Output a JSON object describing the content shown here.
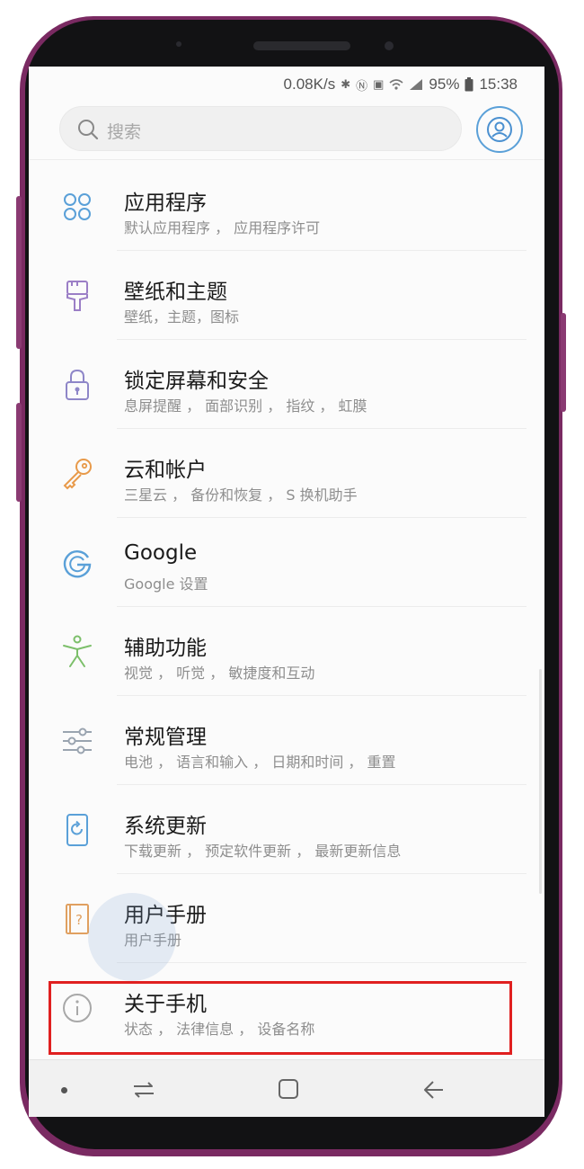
{
  "status_bar": {
    "net_speed": "0.08K/s",
    "battery": "95%",
    "time": "15:38"
  },
  "search": {
    "placeholder": "搜索"
  },
  "settings": {
    "items": [
      {
        "title": "应用程序",
        "subtitle": "默认应用程序 ， 应用程序许可",
        "icon": "apps-icon"
      },
      {
        "title": "壁纸和主题",
        "subtitle": "壁纸，主题，图标",
        "icon": "brush-icon"
      },
      {
        "title": "锁定屏幕和安全",
        "subtitle": "息屏提醒 ， 面部识别 ， 指纹 ， 虹膜",
        "icon": "lock-icon"
      },
      {
        "title": "云和帐户",
        "subtitle": "三星云 ， 备份和恢复 ， S 换机助手",
        "icon": "key-icon"
      },
      {
        "title": "Google",
        "subtitle": "Google 设置",
        "icon": "google-icon"
      },
      {
        "title": "辅助功能",
        "subtitle": "视觉 ， 听觉 ， 敏捷度和互动",
        "icon": "accessibility-icon"
      },
      {
        "title": "常规管理",
        "subtitle": "电池 ， 语言和输入 ， 日期和时间 ， 重置",
        "icon": "sliders-icon"
      },
      {
        "title": "系统更新",
        "subtitle": "下载更新 ， 预定软件更新 ， 最新更新信息",
        "icon": "update-icon"
      },
      {
        "title": "用户手册",
        "subtitle": "用户手册",
        "icon": "manual-icon"
      },
      {
        "title": "关于手机",
        "subtitle": "状态 ， 法律信息 ， 设备名称",
        "icon": "info-icon"
      }
    ]
  },
  "colors": {
    "frame": "#7a2a62",
    "accent_blue": "#5aa0d8",
    "highlight": "#e02020"
  }
}
